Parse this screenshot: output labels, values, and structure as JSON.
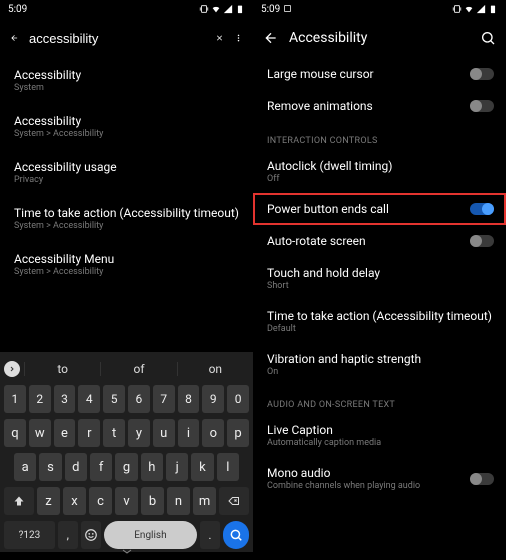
{
  "left": {
    "time": "5:09",
    "search_value": "accessibility",
    "results": [
      {
        "title": "Accessibility",
        "sub": "System"
      },
      {
        "title": "Accessibility",
        "sub": "System > Accessibility"
      },
      {
        "title": "Accessibility usage",
        "sub": "Privacy"
      },
      {
        "title": "Time to take action (Accessibility timeout)",
        "sub": "System > Accessibility"
      },
      {
        "title": "Accessibility Menu",
        "sub": "System > Accessibility"
      }
    ],
    "suggestions": [
      "to",
      "of",
      "on"
    ],
    "kb_rows": {
      "num": [
        "1",
        "2",
        "3",
        "4",
        "5",
        "6",
        "7",
        "8",
        "9",
        "0"
      ],
      "r1": [
        "q",
        "w",
        "e",
        "r",
        "t",
        "y",
        "u",
        "i",
        "o",
        "p"
      ],
      "r2": [
        "a",
        "s",
        "d",
        "f",
        "g",
        "h",
        "j",
        "k",
        "l"
      ],
      "r3": [
        "z",
        "x",
        "c",
        "v",
        "b",
        "n",
        "m"
      ]
    },
    "kb_sym": "?123",
    "kb_space": "English",
    "kb_comma": ",",
    "kb_period": "."
  },
  "right": {
    "time": "5:09",
    "title": "Accessibility",
    "items": [
      {
        "title": "Large mouse cursor",
        "toggle": "off"
      },
      {
        "title": "Remove animations",
        "toggle": "off"
      }
    ],
    "section_interaction": "INTERACTION CONTROLS",
    "interaction_items": [
      {
        "title": "Autoclick (dwell timing)",
        "sub": "Off"
      },
      {
        "title": "Power button ends call",
        "toggle": "on",
        "highlight": true
      },
      {
        "title": "Auto-rotate screen",
        "toggle": "off"
      },
      {
        "title": "Touch and hold delay",
        "sub": "Short"
      },
      {
        "title": "Time to take action (Accessibility timeout)",
        "sub": "Default"
      },
      {
        "title": "Vibration and haptic strength",
        "sub": "On"
      }
    ],
    "section_audio": "AUDIO AND ON-SCREEN TEXT",
    "audio_items": [
      {
        "title": "Live Caption",
        "sub": "Automatically caption media"
      },
      {
        "title": "Mono audio",
        "sub": "Combine channels when playing audio",
        "toggle": "off"
      }
    ]
  }
}
